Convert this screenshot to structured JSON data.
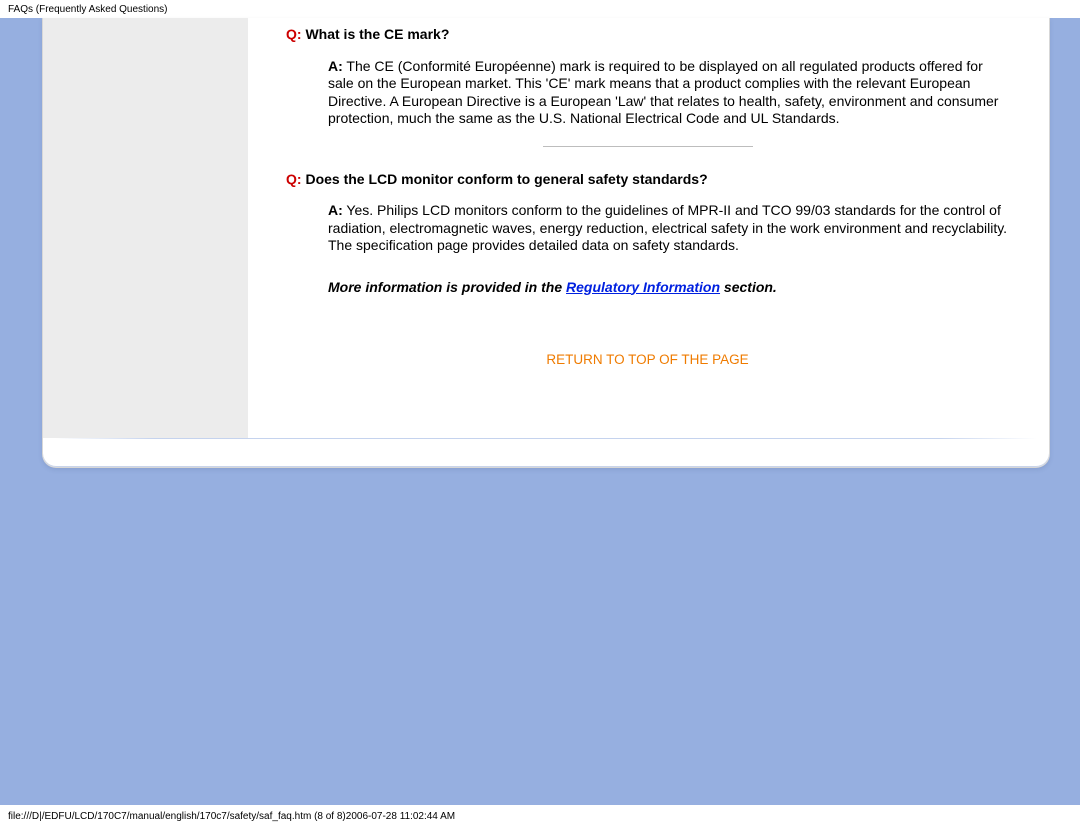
{
  "header": "FAQs (Frequently Asked Questions)",
  "footer": "file:///D|/EDFU/LCD/170C7/manual/english/170c7/safety/saf_faq.htm (8 of 8)2006-07-28 11:02:44 AM",
  "faq1": {
    "q_prefix": "Q:",
    "q_text": " What is the CE mark?",
    "a_prefix": "A:",
    "a_text": " The CE (Conformité Européenne) mark is required to be displayed on all regulated products offered for sale on the European market. This 'CE' mark means that a product complies with the relevant European Directive. A European Directive is a European 'Law' that relates to health, safety, environment and consumer protection, much the same as the U.S. National Electrical Code and UL Standards."
  },
  "faq2": {
    "q_prefix": "Q:",
    "q_text": " Does the LCD monitor conform to general safety standards?",
    "a_prefix": "A:",
    "a_text": " Yes. Philips LCD monitors conform to the guidelines of MPR-II and TCO 99/03 standards for the control of radiation, electromagnetic waves, energy reduction, electrical safety in the work environment and recyclability. The specification page provides detailed data on safety standards."
  },
  "info": {
    "pre": "More information is provided in the ",
    "link": "Regulatory Information",
    "post": " section."
  },
  "return_link": "RETURN TO TOP OF THE PAGE"
}
